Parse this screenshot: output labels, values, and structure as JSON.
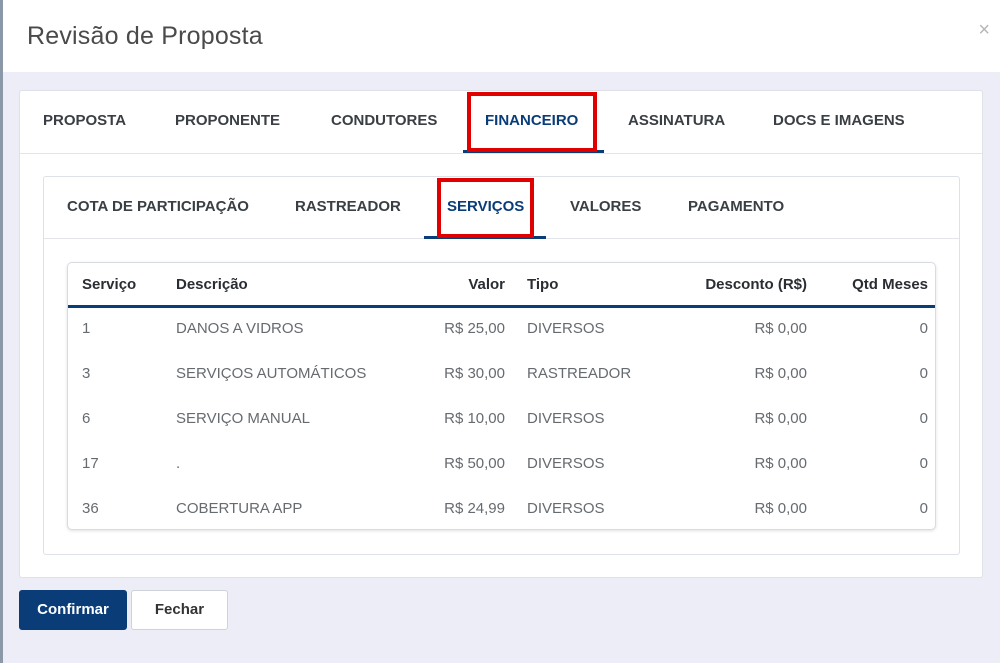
{
  "modal": {
    "title": "Revisão de Proposta",
    "close_label": "×"
  },
  "tabs": [
    {
      "label": "PROPOSTA",
      "active": false
    },
    {
      "label": "PROPONENTE",
      "active": false
    },
    {
      "label": "CONDUTORES",
      "active": false
    },
    {
      "label": "FINANCEIRO",
      "active": true
    },
    {
      "label": "ASSINATURA",
      "active": false
    },
    {
      "label": "DOCS E IMAGENS",
      "active": false
    }
  ],
  "subtabs": [
    {
      "label": "COTA DE PARTICIPAÇÃO",
      "active": false
    },
    {
      "label": "RASTREADOR",
      "active": false
    },
    {
      "label": "SERVIÇOS",
      "active": true
    },
    {
      "label": "VALORES",
      "active": false
    },
    {
      "label": "PAGAMENTO",
      "active": false
    }
  ],
  "table": {
    "headers": [
      "Serviço",
      "Descrição",
      "Valor",
      "Tipo",
      "Desconto (R$)",
      "Qtd Meses"
    ],
    "rows": [
      [
        "1",
        "DANOS A VIDROS",
        "R$ 25,00",
        "DIVERSOS",
        "R$ 0,00",
        "0"
      ],
      [
        "3",
        "SERVIÇOS AUTOMÁTICOS",
        "R$ 30,00",
        "RASTREADOR",
        "R$ 0,00",
        "0"
      ],
      [
        "6",
        "SERVIÇO MANUAL",
        "R$ 10,00",
        "DIVERSOS",
        "R$ 0,00",
        "0"
      ],
      [
        "17",
        ".",
        "R$ 50,00",
        "DIVERSOS",
        "R$ 0,00",
        "0"
      ],
      [
        "36",
        "COBERTURA APP",
        "R$ 24,99",
        "DIVERSOS",
        "R$ 0,00",
        "0"
      ]
    ]
  },
  "buttons": {
    "confirm_label": "Confirmar",
    "close_label": "Fechar"
  },
  "colors": {
    "accent": "#0a3d78",
    "highlight": "#e10000"
  }
}
